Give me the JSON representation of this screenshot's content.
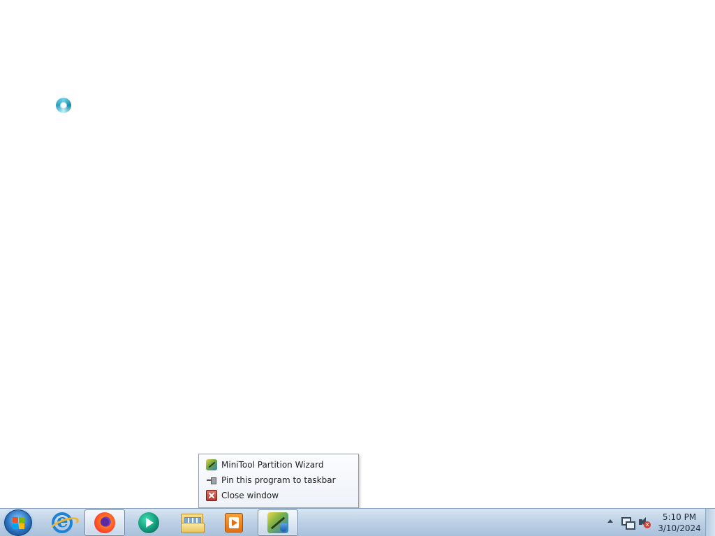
{
  "desktop": {
    "cursor": "busy-cursor"
  },
  "jump_menu": {
    "items": [
      {
        "label": "MiniTool Partition Wizard",
        "icon": "minitool-partition-wizard-icon"
      },
      {
        "label": "Pin this program to taskbar",
        "icon": "pin-icon"
      },
      {
        "label": "Close window",
        "icon": "close-window-icon"
      }
    ]
  },
  "taskbar": {
    "start_icon": "windows-start-orb",
    "apps": [
      {
        "name": "Internet Explorer",
        "icon": "internet-explorer-icon",
        "active": false
      },
      {
        "name": "Firefox",
        "icon": "firefox-icon",
        "active": true
      },
      {
        "name": "Media Center",
        "icon": "media-center-icon",
        "active": false
      },
      {
        "name": "Windows Explorer",
        "icon": "folder-icon",
        "active": false
      },
      {
        "name": "Media Player",
        "icon": "media-player-icon",
        "active": false
      },
      {
        "name": "MiniTool Partition Wizard",
        "icon": "minitool-partition-wizard-icon",
        "active": true
      }
    ],
    "tray": {
      "time": "5:10 PM",
      "date": "3/10/2024",
      "icons": [
        "show-hidden-icons-arrow",
        "network-icon",
        "volume-muted-icon"
      ]
    }
  },
  "colors": {
    "taskbar": "#bfd2e6",
    "menu_border": "#979da6",
    "desktop": "#ffffff"
  }
}
